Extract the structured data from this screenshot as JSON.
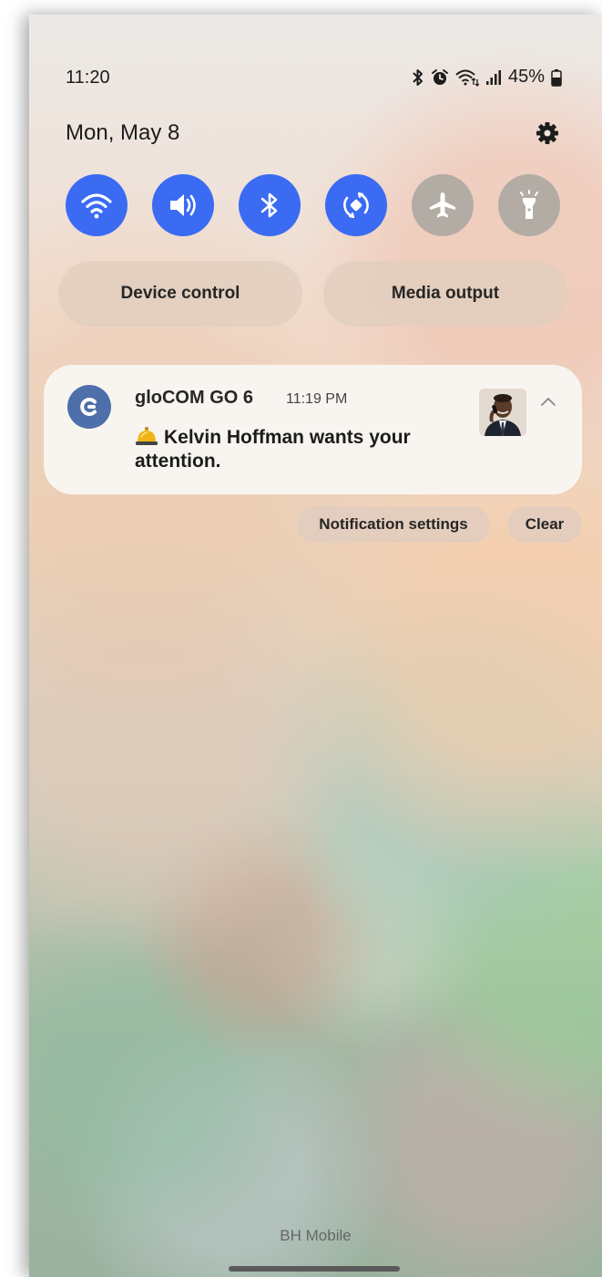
{
  "status_bar": {
    "time": "11:20",
    "battery_percent": "45%",
    "icons": [
      "bluetooth-icon",
      "alarm-icon",
      "wifi-calling-icon",
      "signal-icon",
      "battery-icon"
    ]
  },
  "header": {
    "date": "Mon, May 8",
    "settings_icon": "gear-icon"
  },
  "quick_toggles": [
    {
      "icon": "wifi-icon",
      "state": "on"
    },
    {
      "icon": "sound-icon",
      "state": "on"
    },
    {
      "icon": "bluetooth-icon",
      "state": "on"
    },
    {
      "icon": "auto-rotate-icon",
      "state": "on"
    },
    {
      "icon": "airplane-icon",
      "state": "off"
    },
    {
      "icon": "flashlight-icon",
      "state": "off"
    }
  ],
  "buttons": {
    "device_control": "Device control",
    "media_output": "Media output"
  },
  "notification": {
    "app_name": "gloCOM GO 6",
    "time": "11:19 PM",
    "message": "Kelvin Hoffman wants your attention.",
    "message_icon": "bell-icon"
  },
  "notification_actions": {
    "settings": "Notification settings",
    "clear": "Clear"
  },
  "carrier": "BH Mobile",
  "colors": {
    "toggle_on": "#3a6bf2",
    "toggle_off": "#b3aca4",
    "app_icon": "#4e6fa9"
  }
}
